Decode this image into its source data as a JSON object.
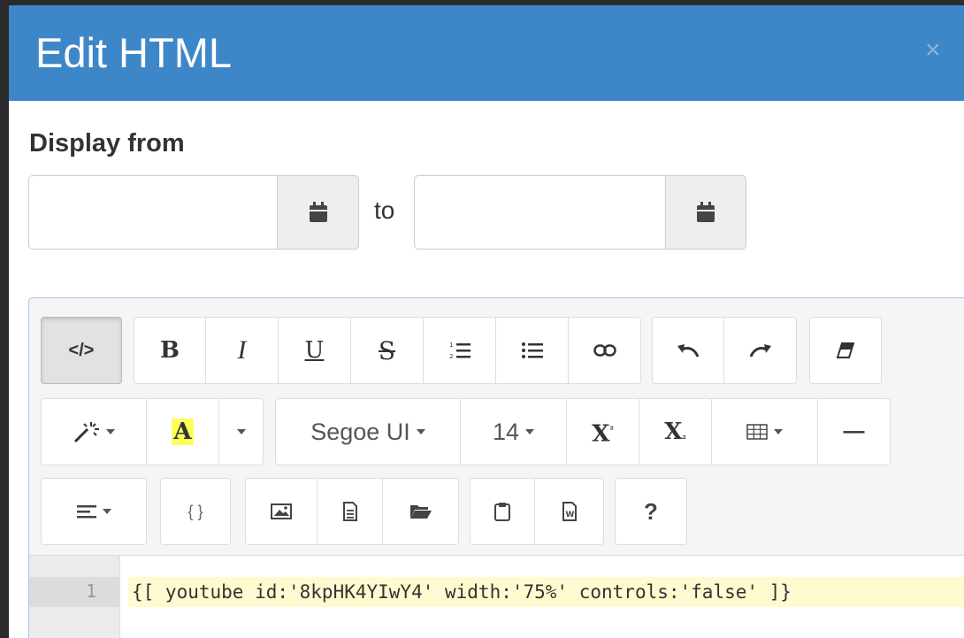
{
  "modal": {
    "title": "Edit HTML",
    "close_label": "×"
  },
  "display": {
    "label": "Display from",
    "from_value": "",
    "to_label": "to",
    "to_value": "",
    "calendar_icon": "calendar-icon"
  },
  "toolbar": {
    "code_view": "</>",
    "bold": "B",
    "italic": "I",
    "underline": "U",
    "strikethrough": "S",
    "font_name": "Segoe UI",
    "font_size": "14",
    "highlight_letter": "A",
    "braces": "{ }",
    "help": "?",
    "superscript": "X",
    "superscript_mark": "²",
    "subscript": "X",
    "subscript_mark": "₂",
    "hr": "—"
  },
  "code": {
    "line_number": "1",
    "line_text": "{[ youtube id:'8kpHK4YIwY4' width:'75%' controls:'false' ]}"
  },
  "colors": {
    "header": "#3d87c9",
    "highlight": "#ffff5a"
  }
}
